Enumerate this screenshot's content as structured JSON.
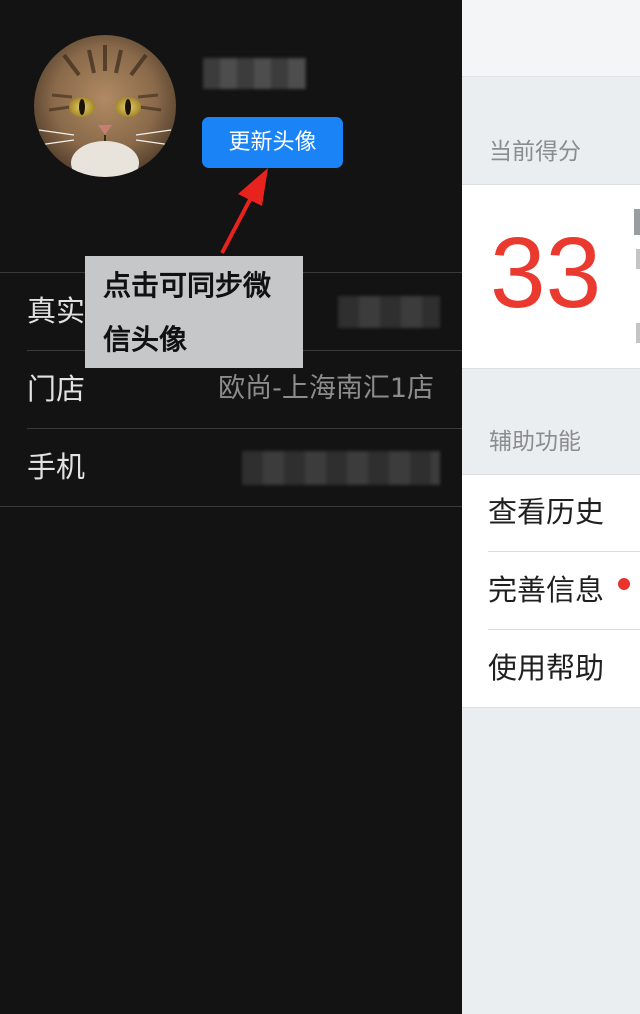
{
  "drawer": {
    "update_avatar_label": "更新头像",
    "rows": [
      {
        "label": "真实姓名",
        "value": ""
      },
      {
        "label": "门店",
        "value": "欧尚-上海南汇1店"
      },
      {
        "label": "手机",
        "value": ""
      }
    ]
  },
  "annotation": {
    "line1": "点击可同步微",
    "line2": "信头像",
    "arrow_color": "#e8231e"
  },
  "panel": {
    "score_title": "当前得分",
    "score_value": "33",
    "aux_title": "辅助功能",
    "menu": [
      {
        "label": "查看历史"
      },
      {
        "label": "完善信息",
        "badge": "red-dot"
      },
      {
        "label": "使用帮助"
      }
    ]
  },
  "colors": {
    "accent": "#1a84f7",
    "score": "#ea3a2f",
    "drawer_bg": "#131313",
    "panel_bg": "#ebeef1"
  }
}
